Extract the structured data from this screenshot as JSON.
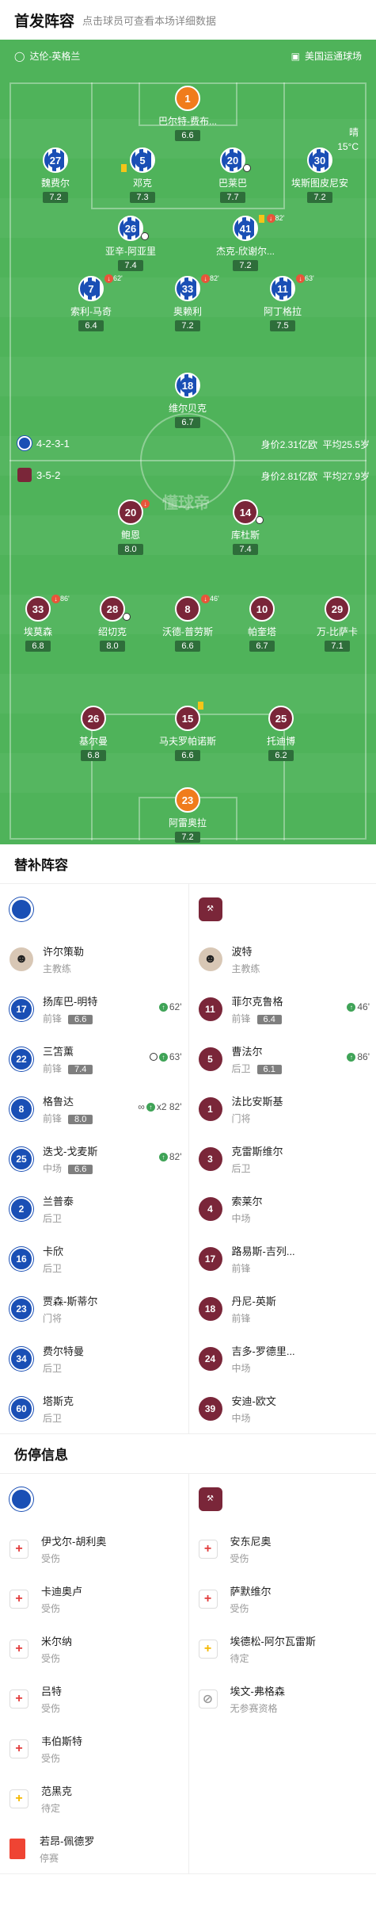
{
  "header": {
    "title": "首发阵容",
    "subtitle": "点击球员可查看本场详细数据"
  },
  "pitch": {
    "home_team": "达伦-英格兰",
    "stadium": "美国运通球场",
    "weather": "晴",
    "temp": "15°C",
    "watermark": "懂球帝",
    "home_formation": "4-2-3-1",
    "home_value": "身价2.31亿欧",
    "home_age": "平均25.5岁",
    "away_formation": "3-5-2",
    "away_value": "身价2.81亿欧",
    "away_age": "平均27.9岁"
  },
  "players": [
    {
      "num": "1",
      "name": "巴尔特-费布...",
      "rating": "6.6",
      "team": "gk"
    },
    {
      "num": "27",
      "name": "魏费尔",
      "rating": "7.2",
      "team": "bri"
    },
    {
      "num": "5",
      "name": "邓克",
      "rating": "7.3",
      "team": "bri"
    },
    {
      "num": "20",
      "name": "巴莱巴",
      "rating": "7.7",
      "team": "bri"
    },
    {
      "num": "30",
      "name": "埃斯图皮尼安",
      "rating": "7.2",
      "team": "bri"
    },
    {
      "num": "26",
      "name": "亚辛-阿亚里",
      "rating": "7.4",
      "team": "bri"
    },
    {
      "num": "41",
      "name": "杰克-欣谢尔...",
      "rating": "7.2",
      "team": "bri",
      "ev": "82'"
    },
    {
      "num": "7",
      "name": "索利-马奇",
      "rating": "6.4",
      "team": "bri",
      "ev": "62'"
    },
    {
      "num": "33",
      "name": "奥赖利",
      "rating": "7.2",
      "team": "bri",
      "ev": "82'"
    },
    {
      "num": "11",
      "name": "阿丁格拉",
      "rating": "7.5",
      "team": "bri",
      "ev": "63'"
    },
    {
      "num": "18",
      "name": "维尔贝克",
      "rating": "6.7",
      "team": "bri"
    },
    {
      "num": "20",
      "name": "鲍恩",
      "rating": "8.0",
      "team": "whu"
    },
    {
      "num": "14",
      "name": "库杜斯",
      "rating": "7.4",
      "team": "whu"
    },
    {
      "num": "33",
      "name": "埃莫森",
      "rating": "6.8",
      "team": "whu",
      "ev": "86'"
    },
    {
      "num": "28",
      "name": "绍切克",
      "rating": "8.0",
      "team": "whu"
    },
    {
      "num": "8",
      "name": "沃德-普劳斯",
      "rating": "6.6",
      "team": "whu",
      "ev": "46'"
    },
    {
      "num": "10",
      "name": "帕奎塔",
      "rating": "6.7",
      "team": "whu"
    },
    {
      "num": "29",
      "name": "万-比萨卡",
      "rating": "7.1",
      "team": "whu"
    },
    {
      "num": "26",
      "name": "基尔曼",
      "rating": "6.8",
      "team": "whu"
    },
    {
      "num": "15",
      "name": "马夫罗帕诺斯",
      "rating": "6.6",
      "team": "whu"
    },
    {
      "num": "25",
      "name": "托迪博",
      "rating": "6.2",
      "team": "whu"
    },
    {
      "num": "23",
      "name": "阿雷奥拉",
      "rating": "7.2",
      "team": "gk"
    }
  ],
  "subs": {
    "title": "替补阵容",
    "home": [
      {
        "num": "17",
        "name": "扬库巴-明特",
        "pos": "前锋",
        "rating": "6.6",
        "ev": "62'"
      },
      {
        "num": "22",
        "name": "三笘薰",
        "pos": "前锋",
        "rating": "7.4",
        "ev": "63'"
      },
      {
        "num": "8",
        "name": "格鲁达",
        "pos": "前锋",
        "rating": "8.0",
        "ev": "x2 82'"
      },
      {
        "num": "25",
        "name": "迭戈-戈麦斯",
        "pos": "中场",
        "rating": "6.6",
        "ev": "82'"
      },
      {
        "num": "2",
        "name": "兰普泰",
        "pos": "后卫"
      },
      {
        "num": "16",
        "name": "卡欣",
        "pos": "后卫"
      },
      {
        "num": "23",
        "name": "贾森-斯蒂尔",
        "pos": "门将"
      },
      {
        "num": "34",
        "name": "费尔特曼",
        "pos": "后卫"
      },
      {
        "num": "60",
        "name": "塔斯克",
        "pos": "后卫"
      }
    ],
    "away": [
      {
        "num": "11",
        "name": "菲尔克鲁格",
        "pos": "前锋",
        "rating": "6.4",
        "ev": "46'"
      },
      {
        "num": "5",
        "name": "曹法尔",
        "pos": "后卫",
        "rating": "6.1",
        "ev": "86'"
      },
      {
        "num": "1",
        "name": "法比安斯基",
        "pos": "门将"
      },
      {
        "num": "3",
        "name": "克雷斯维尔",
        "pos": "后卫"
      },
      {
        "num": "4",
        "name": "索莱尔",
        "pos": "中场"
      },
      {
        "num": "17",
        "name": "路易斯-吉列...",
        "pos": "前锋"
      },
      {
        "num": "18",
        "name": "丹尼-英斯",
        "pos": "前锋"
      },
      {
        "num": "24",
        "name": "吉多-罗德里...",
        "pos": "中场"
      },
      {
        "num": "39",
        "name": "安迪-欧文",
        "pos": "中场"
      }
    ],
    "home_coach": {
      "name": "许尔策勒",
      "role": "主教练"
    },
    "away_coach": {
      "name": "波特",
      "role": "主教练"
    }
  },
  "inj": {
    "title": "伤停信息",
    "home": [
      {
        "name": "伊戈尔-胡利奥",
        "st": "受伤",
        "t": "red"
      },
      {
        "name": "卡迪奥卢",
        "st": "受伤",
        "t": "red"
      },
      {
        "name": "米尔纳",
        "st": "受伤",
        "t": "red"
      },
      {
        "name": "吕特",
        "st": "受伤",
        "t": "red"
      },
      {
        "name": "韦伯斯特",
        "st": "受伤",
        "t": "red"
      },
      {
        "name": "范黑克",
        "st": "待定",
        "t": "yel"
      },
      {
        "name": "若昂-佩德罗",
        "st": "停赛",
        "t": "card"
      }
    ],
    "away": [
      {
        "name": "安东尼奥",
        "st": "受伤",
        "t": "red"
      },
      {
        "name": "萨默维尔",
        "st": "受伤",
        "t": "red"
      },
      {
        "name": "埃德松-阿尔瓦雷斯",
        "st": "待定",
        "t": "yel"
      },
      {
        "name": "埃文-弗格森",
        "st": "无参赛资格",
        "t": "gry"
      }
    ]
  }
}
